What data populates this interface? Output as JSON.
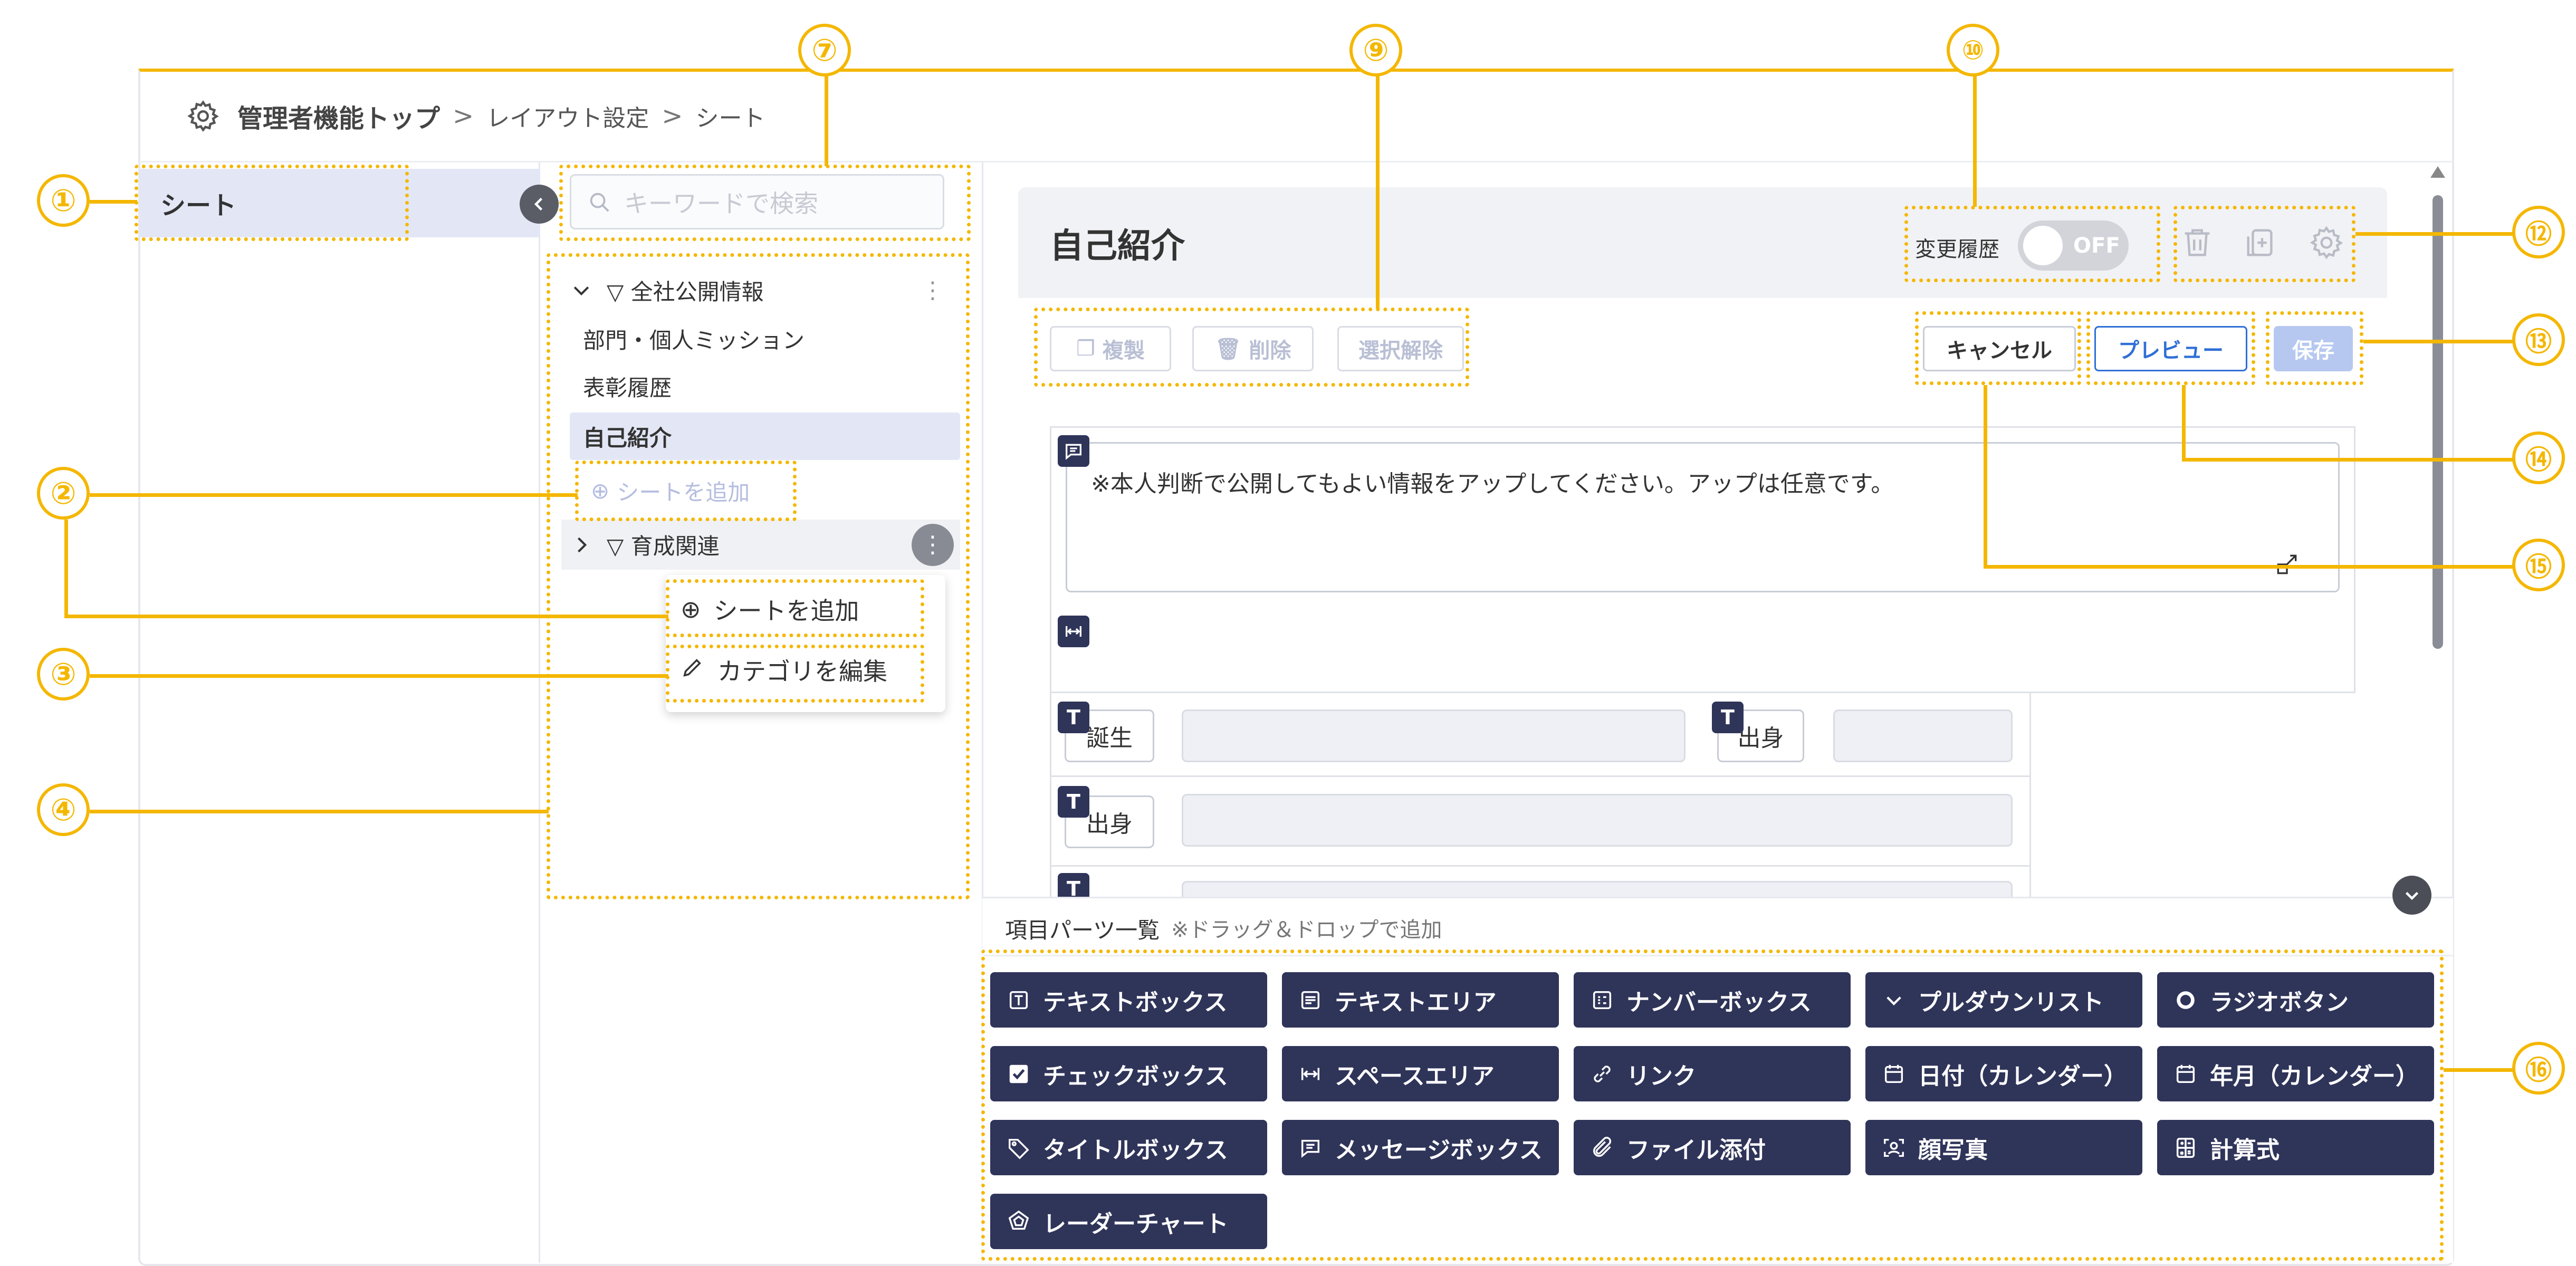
{
  "breadcrumb": {
    "home": "管理者機能トップ",
    "sep1": ">",
    "layout": "レイアウト設定",
    "sep2": ">",
    "current": "シート"
  },
  "sidebar": {
    "item_label": "シート"
  },
  "search": {
    "placeholder": "キーワードで検索"
  },
  "tree": {
    "category1": {
      "label": "▽ 全社公開情報",
      "items": [
        "部門・個人ミッション",
        "表彰履歴",
        "自己紹介"
      ],
      "add_sheet": "シートを追加"
    },
    "category2": {
      "label": "▽ 育成関連"
    },
    "menu": {
      "add_sheet": "シートを追加",
      "edit_category": "カテゴリを編集"
    }
  },
  "sheet": {
    "title": "自己紹介",
    "history_label": "変更履歴",
    "toggle_state": "OFF",
    "actions": {
      "copy": "複製",
      "delete": "削除",
      "deselect": "選択解除",
      "cancel": "キャンセル",
      "preview": "プレビュー",
      "save": "保存"
    },
    "message": "※本人判断で公開してもよい情報をアップしてください。アップは任意です。",
    "field_labels": [
      "誕生",
      "出身",
      "出身"
    ]
  },
  "parts": {
    "title": "項目パーツ一覧",
    "hint": "※ドラッグ＆ドロップで追加",
    "items": [
      "テキストボックス",
      "テキストエリア",
      "ナンバーボックス",
      "プルダウンリスト",
      "ラジオボタン",
      "チェックボックス",
      "スペースエリア",
      "リンク",
      "日付（カレンダー）",
      "年月（カレンダー）",
      "タイトルボックス",
      "メッセージボックス",
      "ファイル添付",
      "顔写真",
      "計算式",
      "レーダーチャート"
    ]
  },
  "callouts": [
    "①",
    "②",
    "③",
    "④",
    "⑦",
    "⑨",
    "⑩",
    "⑫",
    "⑬",
    "⑭",
    "⑮",
    "⑯"
  ],
  "colors": {
    "accent": "#f4b700",
    "navy": "#2f3459",
    "primary_blue": "#2f6fd6",
    "selected_bg": "#e3e7f5"
  },
  "icons": {
    "settings": "gear-icon",
    "search": "search-icon",
    "trash": "trash-icon",
    "copy": "copy-icon",
    "collapse": "chevron-left-icon",
    "expand": "chevron-down-icon"
  }
}
